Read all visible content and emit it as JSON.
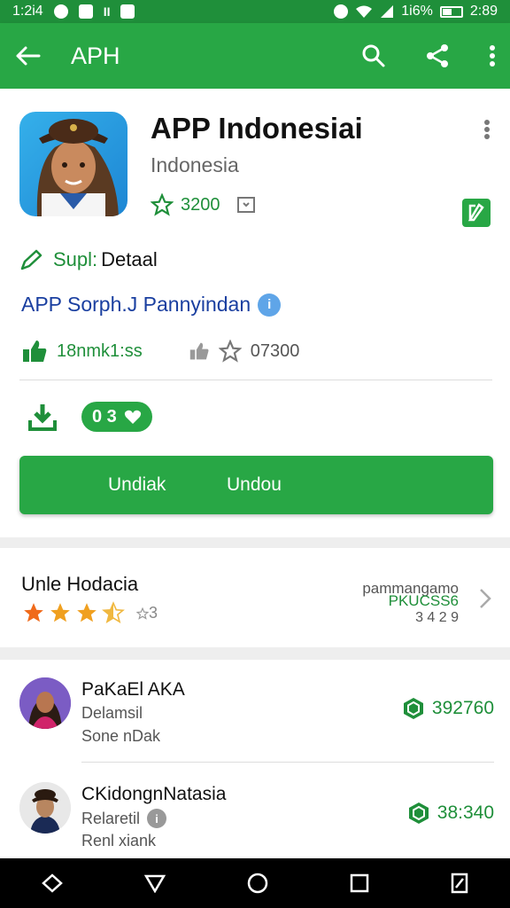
{
  "status_bar": {
    "time_left": "1:2i4",
    "battery": "1i6%",
    "time_right": "2:89"
  },
  "app_bar": {
    "title": "APH"
  },
  "app": {
    "name": "APP Indonesiai",
    "subtitle": "Indonesia",
    "rating_value": "3200",
    "developer_prefix": "Supl:",
    "developer_label": "Detaal",
    "category": "APP Sorph.J Pannyindan",
    "category_badge": "i",
    "likes": "18nmk1:ss",
    "rating_count": "07300",
    "pill_value": "0 3",
    "install_label_left": "Undiak",
    "install_label_right": "Undou"
  },
  "rating_section": {
    "title": "Unle Hodacia",
    "stars": 3.5,
    "count": "3",
    "right_line1": "pammangamo",
    "right_line2": "PKUCSS6",
    "right_line3": "3 4 2 9"
  },
  "reviews": [
    {
      "name": "PaKaEl AKA",
      "line2": "Delamsil",
      "line3": "Sone nDak",
      "score": "392760"
    },
    {
      "name": "CKidongnNatasia",
      "line2": "Relaretil",
      "line3": "Renl xiank",
      "score": "38:340"
    }
  ],
  "colors": {
    "primary": "#28a745",
    "status": "#1f8f3a",
    "link_blue": "#1a3fa0",
    "star": "#f06a1a"
  }
}
